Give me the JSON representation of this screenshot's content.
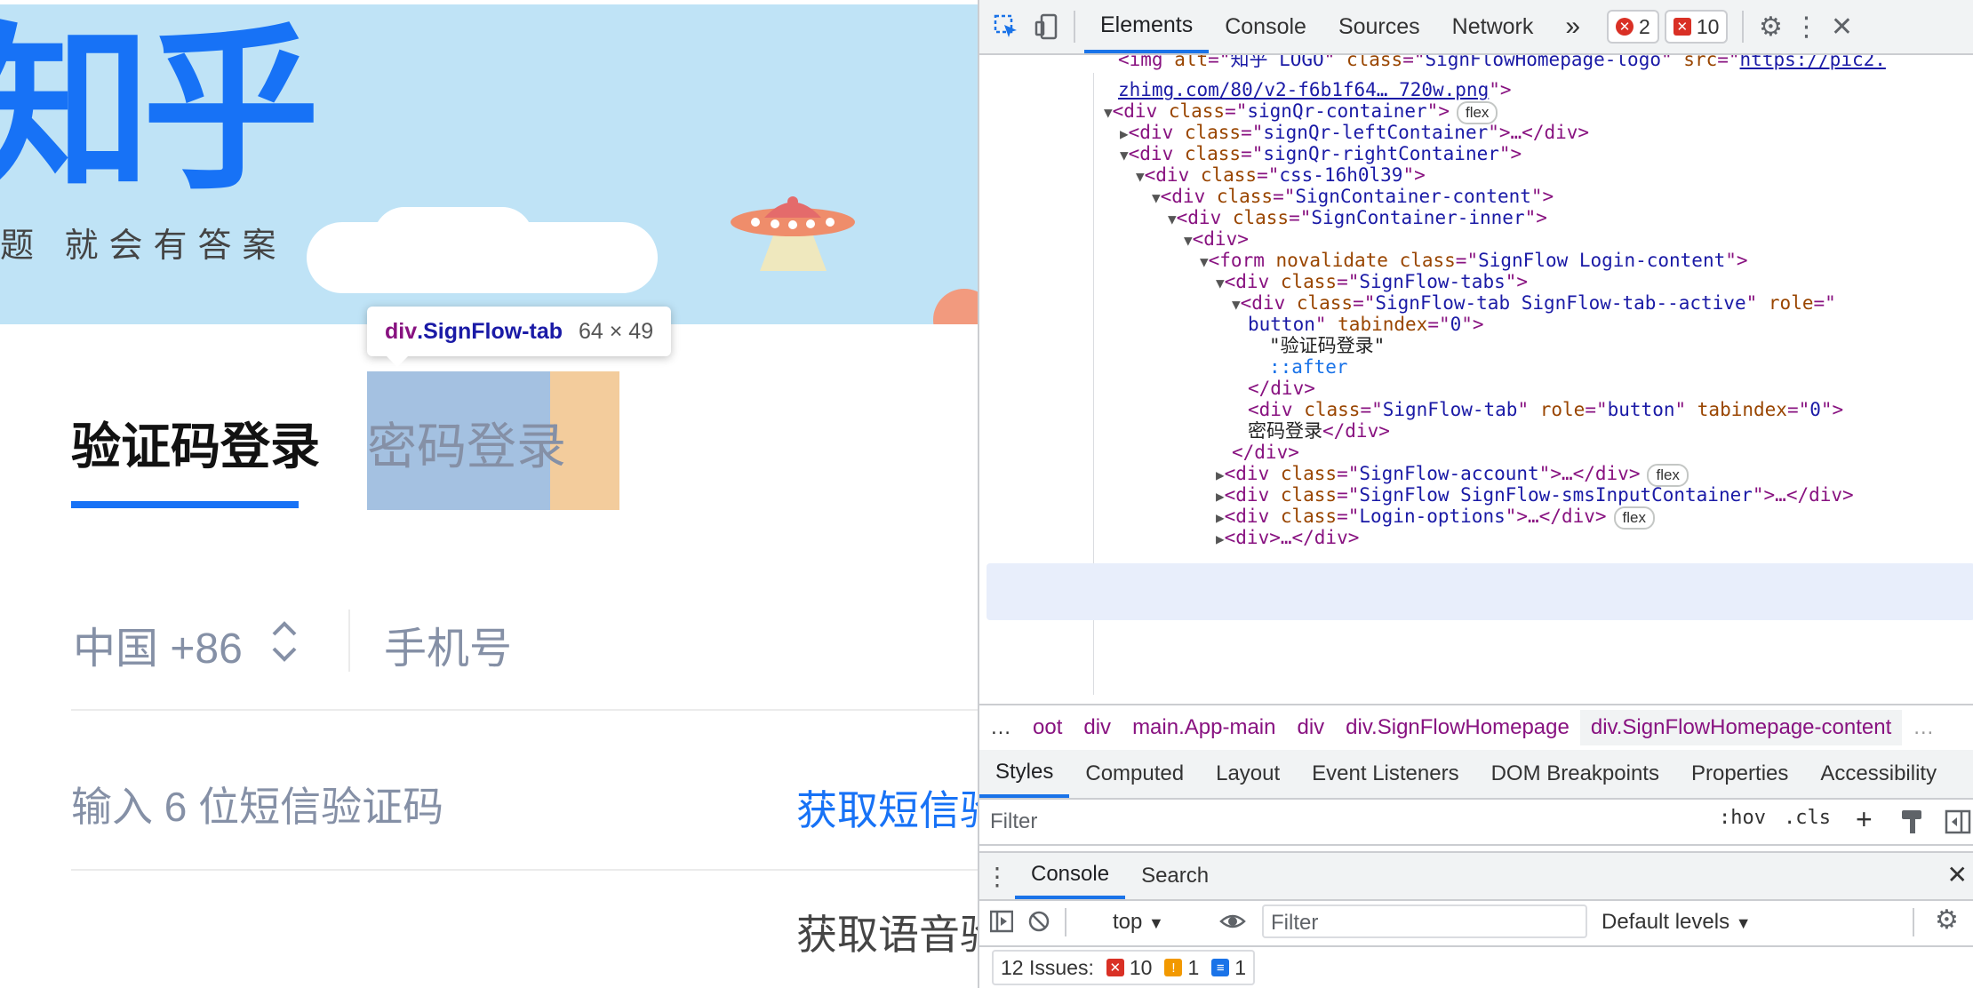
{
  "page": {
    "logo_text": "知乎",
    "slogan": "题 就会有答案",
    "tabs": {
      "sms": "验证码登录",
      "password": "密码登录"
    },
    "tooltip": {
      "tag": "div",
      "class_name": ".SignFlow-tab",
      "size": "64 × 49"
    },
    "country_code": "中国 +86",
    "phone_placeholder": "手机号",
    "code_placeholder": "输入 6 位短信验证码",
    "get_sms_code": "获取短信验证码",
    "get_voice_code": "获取语音验证码",
    "colors": {
      "brand": "#1772f6",
      "banner": "#bfe3f6",
      "highlight_content": "#a4c1e1",
      "highlight_padding": "#f3cc9c"
    }
  },
  "devtools": {
    "tabs": [
      "Elements",
      "Console",
      "Sources",
      "Network"
    ],
    "more_tabs": "»",
    "error_count": "2",
    "issue_count": "10",
    "dom": {
      "img_alt": "知乎 LOGO",
      "img_class": "SignFlowHomepage-logo",
      "img_src_1": "https://pic2.",
      "img_src_2": "zhimg.com/80/v2-f6b1f64… 720w.png",
      "flex": "flex",
      "lines": {
        "qr_container": "signQr-container",
        "qr_left": "signQr-leftContainer",
        "qr_right": "signQr-rightContainer",
        "css_class": "css-16h0l39",
        "sign_content": "SignContainer-content",
        "sign_inner": "SignContainer-inner",
        "form_class": "SignFlow Login-content",
        "tabs_class": "SignFlow-tabs",
        "tab_active_class": "SignFlow-tab SignFlow-tab--active",
        "role_button": "button",
        "tabindex": "0",
        "tab_active_text": "\"验证码登录\"",
        "after": "::after",
        "tab_class": "SignFlow-tab",
        "tab_text": "密码登录",
        "account_class": "SignFlow-account",
        "sms_class": "SignFlow SignFlow-smsInputContainer",
        "options_class": "Login-options"
      }
    },
    "breadcrumbs": [
      "…",
      "oot",
      "div",
      "main.App-main",
      "div",
      "div.SignFlowHomepage",
      "div.SignFlowHomepage-content",
      "…"
    ],
    "style_tabs": [
      "Styles",
      "Computed",
      "Layout",
      "Event Listeners",
      "DOM Breakpoints",
      "Properties",
      "Accessibility"
    ],
    "filter_placeholder": "Filter",
    "hov": ":hov",
    "cls": ".cls",
    "drawer_tabs": [
      "Console",
      "Search"
    ],
    "context": "top",
    "console_filter": "Filter",
    "levels": "Default levels",
    "issues_label": "12 Issues:",
    "issues_errors": "10",
    "issues_warnings": "1",
    "issues_info": "1"
  }
}
